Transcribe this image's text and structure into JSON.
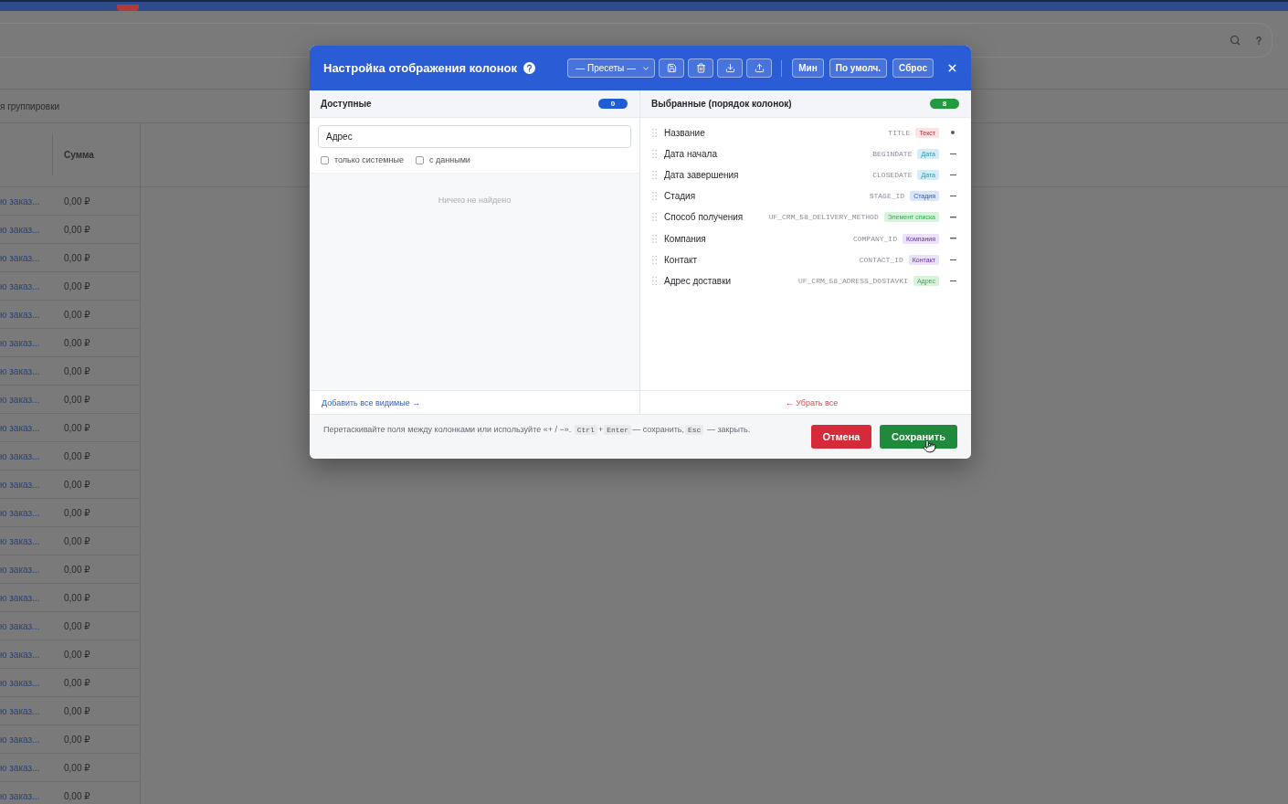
{
  "app_background": {
    "grouping_label": "я группировки",
    "table": {
      "columns": [
        {
          "label": "Сумма"
        }
      ],
      "rows": [
        {
          "column_1": "ю заказ...",
          "sum": "0,00 ₽"
        },
        {
          "column_1": "ю заказ...",
          "sum": "0,00 ₽"
        },
        {
          "column_1": "ю заказ...",
          "sum": "0,00 ₽"
        },
        {
          "column_1": "ю заказ...",
          "sum": "0,00 ₽"
        },
        {
          "column_1": "ю заказ...",
          "sum": "0,00 ₽"
        },
        {
          "column_1": "ю заказ...",
          "sum": "0,00 ₽"
        },
        {
          "column_1": "ю заказ...",
          "sum": "0,00 ₽"
        },
        {
          "column_1": "ю заказ...",
          "sum": "0,00 ₽"
        },
        {
          "column_1": "ю заказ...",
          "sum": "0,00 ₽"
        },
        {
          "column_1": "ю заказ...",
          "sum": "0,00 ₽"
        },
        {
          "column_1": "ю заказ...",
          "sum": "0,00 ₽"
        },
        {
          "column_1": "ю заказ...",
          "sum": "0,00 ₽"
        },
        {
          "column_1": "ю заказ...",
          "sum": "0,00 ₽"
        },
        {
          "column_1": "ю заказ...",
          "sum": "0,00 ₽"
        },
        {
          "column_1": "ю заказ...",
          "sum": "0,00 ₽"
        },
        {
          "column_1": "ю заказ...",
          "sum": "0,00 ₽"
        },
        {
          "column_1": "ю заказ...",
          "sum": "0,00 ₽"
        },
        {
          "column_1": "ю заказ...",
          "sum": "0,00 ₽"
        },
        {
          "column_1": "ю заказ...",
          "sum": "0,00 ₽"
        },
        {
          "column_1": "ю заказ...",
          "sum": "0,00 ₽"
        },
        {
          "column_1": "ю заказ...",
          "sum": "0,00 ₽"
        },
        {
          "column_1": "ю заказ...",
          "sum": "0,00 ₽"
        }
      ]
    }
  },
  "dialog": {
    "title": "Настройка отображения колонок",
    "toolbar": {
      "preset_select": {
        "value": "— Пресеты —"
      },
      "buttons": [
        "Мин",
        "По умолч.",
        "Сброс"
      ]
    },
    "available": {
      "title": "Доступные",
      "count": "0",
      "search": {
        "value": "Адрес"
      },
      "filters": [
        {
          "label": "только системные",
          "checked": false
        },
        {
          "label": "с данными",
          "checked": false
        }
      ],
      "empty_text": "Ничего не найдено",
      "add_all_link": "Добавить все видимые →"
    },
    "selected": {
      "title": "Выбранные (порядок колонок)",
      "count": "8",
      "columns": [
        {
          "name": "Название",
          "code": "TITLE",
          "type": "Текст",
          "color": "#fde2e4",
          "removable": false
        },
        {
          "name": "Дата начала",
          "code": "BEGINDATE",
          "type": "Дата",
          "color": "#d3eef6",
          "removable": true
        },
        {
          "name": "Дата завершения",
          "code": "CLOSEDATE",
          "type": "Дата",
          "color": "#d3eef6",
          "removable": true
        },
        {
          "name": "Стадия",
          "code": "STAGE_ID",
          "type": "Стадия",
          "color": "#dae6fd",
          "removable": true
        },
        {
          "name": "Способ получения",
          "code": "UF_CRM_58_DELIVERY_METHOD",
          "type": "Элемент списка",
          "color": "#d9f2de",
          "removable": true
        },
        {
          "name": "Компания",
          "code": "COMPANY_ID",
          "type": "Компания",
          "color": "#ece1fb",
          "removable": true
        },
        {
          "name": "Контакт",
          "code": "CONTACT_ID",
          "type": "Контакт",
          "color": "#ece1fb",
          "removable": true
        },
        {
          "name": "Адрес доставки",
          "code": "UF_CRM_58_ADRESS_DOSTAVKI",
          "type": "Адрес",
          "color": "#d9f2de",
          "removable": true
        }
      ],
      "remove_all_link": "← Убрать все"
    },
    "hint": [
      {
        "kind": "text",
        "text": "Перетаскивайте поля между колонками или используйте «+ / −»."
      },
      {
        "kind": "key",
        "text": "Ctrl"
      },
      {
        "kind": "text",
        "text": "+"
      },
      {
        "kind": "key",
        "text": "Enter"
      },
      {
        "kind": "text",
        "text": "— сохранить,"
      },
      {
        "kind": "key",
        "text": "Esc"
      },
      {
        "kind": "text",
        "text": "— закрыть."
      }
    ],
    "buttons": [
      {
        "kind": "cancel",
        "label": "Отмена"
      },
      {
        "kind": "save",
        "label": "Сохранить"
      }
    ]
  }
}
